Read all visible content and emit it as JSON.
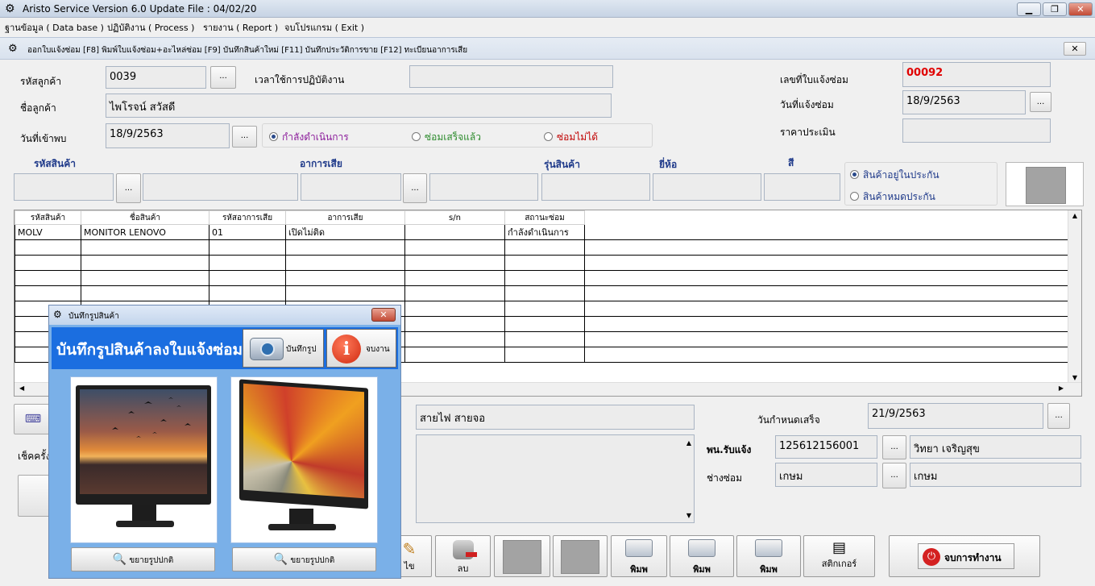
{
  "window": {
    "title": "Aristo Service Version 6.0 Update File : 04/02/20",
    "min_label": "▁",
    "max_label": "❐",
    "close_label": "✕"
  },
  "menu": [
    "ฐานข้อมูล ( Data base )",
    "ปฏิบัติงาน ( Process )",
    "รายงาน ( Report )",
    "จบโปรแกรม ( Exit )"
  ],
  "tab": {
    "text": "ออกใบแจ้งซ่อม  [F8]  พิมพ์ใบแจ้งซ่อม+อะไหล่ซ่อม  [F9] บันทึกสินค้าใหม่ [F11] บันทึกประวัติการขาย [F12] ทะเบียนอาการเสีย",
    "close_label": "✕"
  },
  "form": {
    "cust_code_label": "รหัสลูกค้า",
    "cust_code": "0039",
    "work_time_label": "เวลาใช้การปฏิบัติงาน",
    "work_time": "",
    "ticket_no_label": "เลขที่ใบแจ้งซ่อม",
    "ticket_no": "00092",
    "cust_name_label": "ชื่อลูกค้า",
    "cust_name": "ไพโรจน์ สวัสดี",
    "ticket_date_label": "วันที่แจ้งซ่อม",
    "ticket_date": "18/9/2563",
    "visit_date_label": "วันที่เข้าพบ",
    "visit_date": "18/9/2563",
    "estimate_label": "ราคาประเมิน",
    "estimate": "",
    "status_in_progress": "กำลังดำเนินการ",
    "status_done": "ซ่อมเสร็จแล้ว",
    "status_fail": "ซ่อมไม่ได้",
    "product_code_label": "รหัสสินค้า",
    "symptom_label": "อาการเสีย",
    "model_label": "รุ่นสินค้า",
    "brand_label": "ยี่ห้อ",
    "color_label": "สี",
    "warranty_in": "สินค้าอยู่ในประกัน",
    "warranty_out": "สินค้าหมดประกัน",
    "ellipsis": "..."
  },
  "grid": {
    "columns": [
      "รหัสสินค้า",
      "ชื่อสินค้า",
      "รหัสอาการเสีย",
      "อาการเสีย",
      "s/n",
      "สถานะซ่อม"
    ],
    "rows": [
      [
        "MOLV",
        "MONITOR LENOVO",
        "01",
        "เปิดไม่ติด",
        "",
        "กำลังดำเนินการ"
      ]
    ]
  },
  "lower": {
    "accessories": "สายไฟ สายจอ",
    "check_label": "เช็คครั้ง",
    "due_label": "วันกำหนดเสร็จ",
    "due_date": "21/9/2563",
    "receiver_label": "พน.รับแจ้ง",
    "receiver_code": "125612156001",
    "receiver_name": "วิทยา เจริญสุข",
    "tech_label": "ช่างซ่อม",
    "tech_code": "เกษม",
    "tech_name": "เกษม"
  },
  "buttons": {
    "edit": "ไข",
    "delete": "ลบ",
    "print1": "พิมพ",
    "print2": "พิมพ",
    "print3": "พิมพ",
    "sticker": "สติกเกอร์",
    "exit": "จบการทำงาน"
  },
  "dialog": {
    "title": "บันทึกรูปสินค้า",
    "close_label": "✕",
    "heading": "บันทึกรูปสินค้าลงใบแจ้งซ่อม",
    "save_photo": "บันทึกรูป",
    "finish": "จบงาน",
    "zoom1": "ขยายรูปปกติ",
    "zoom2": "ขยายรูปปกติ"
  },
  "colors": {
    "accent": "#1b6ee0",
    "ticket_no": "#e00000",
    "status_done": "#2a8a2a",
    "status_fail": "#c00000",
    "header_text": "#1f3a8a"
  }
}
